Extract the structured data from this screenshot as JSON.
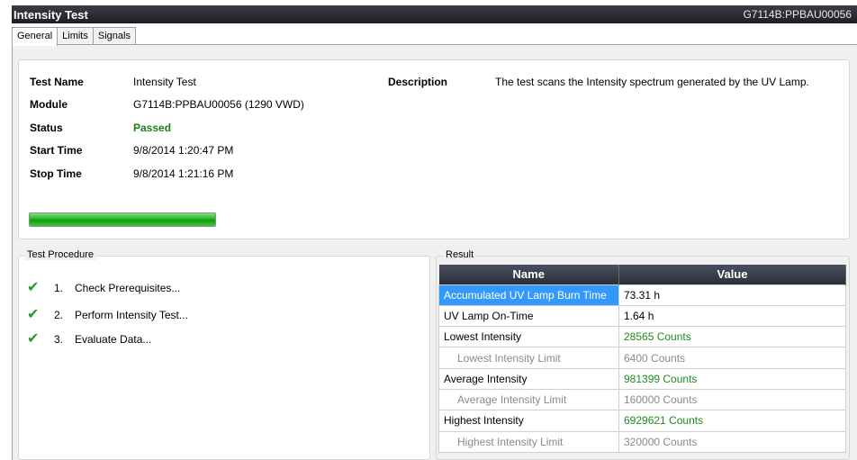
{
  "window": {
    "title": "Intensity Test",
    "module_id": "G7114B:PPBAU00056"
  },
  "tabs": [
    {
      "label": "General",
      "active": true
    },
    {
      "label": "Limits",
      "active": false
    },
    {
      "label": "Signals",
      "active": false
    }
  ],
  "general": {
    "test_name_label": "Test Name",
    "test_name_value": "Intensity Test",
    "module_label": "Module",
    "module_value": "G7114B:PPBAU00056 (1290 VWD)",
    "status_label": "Status",
    "status_value": "Passed",
    "start_time_label": "Start Time",
    "start_time_value": "9/8/2014 1:20:47 PM",
    "stop_time_label": "Stop Time",
    "stop_time_value": "9/8/2014 1:21:16 PM",
    "description_label": "Description",
    "description_value": "The test scans the Intensity spectrum generated by the UV Lamp.",
    "progress_fraction": 1.0
  },
  "procedure": {
    "title": "Test Procedure",
    "steps": [
      {
        "num": "1.",
        "label": "Check Prerequisites...",
        "icon": "check-icon"
      },
      {
        "num": "2.",
        "label": "Perform Intensity Test...",
        "icon": "check-icon"
      },
      {
        "num": "3.",
        "label": "Evaluate Data...",
        "icon": "check-icon"
      }
    ]
  },
  "result": {
    "title": "Result",
    "col_name": "Name",
    "col_value": "Value",
    "rows": [
      {
        "name": "Accumulated UV Lamp Burn Time",
        "value": "73.31 h"
      },
      {
        "name": "UV Lamp On-Time",
        "value": "1.64 h"
      },
      {
        "name": "Lowest Intensity",
        "value": "28565 Counts"
      },
      {
        "name": "Lowest Intensity Limit",
        "value": "6400 Counts"
      },
      {
        "name": "Average Intensity",
        "value": "981399 Counts"
      },
      {
        "name": "Average Intensity Limit",
        "value": "160000 Counts"
      },
      {
        "name": "Highest Intensity",
        "value": "6929621 Counts"
      },
      {
        "name": "Highest Intensity Limit",
        "value": "320000 Counts"
      }
    ]
  },
  "colors": {
    "passed": "#1a7f1a",
    "selection": "#3399ff",
    "value_green": "#1f8a1f"
  }
}
